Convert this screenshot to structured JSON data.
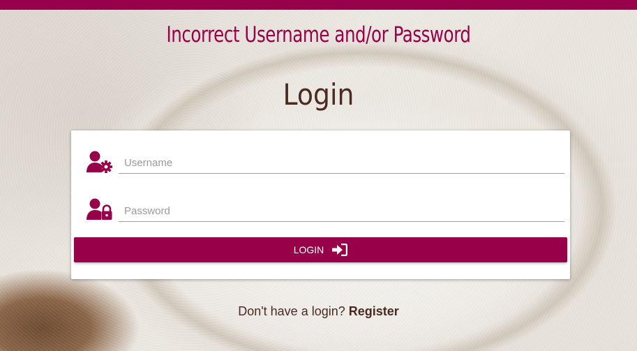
{
  "header": {
    "error_message": "Incorrect Username and/or Password",
    "title": "Login"
  },
  "form": {
    "username_placeholder": "Username",
    "username_value": "",
    "password_placeholder": "Password",
    "password_value": "",
    "login_label": "LOGIN"
  },
  "footer": {
    "prompt": "Don't have a login?",
    "register_label": "Register"
  },
  "icons": {
    "username": "user-gear-icon",
    "password": "user-lock-icon",
    "login": "sign-in-icon"
  },
  "colors": {
    "accent": "#980049",
    "heading": "#4a2a22",
    "card": "#ffffff"
  }
}
